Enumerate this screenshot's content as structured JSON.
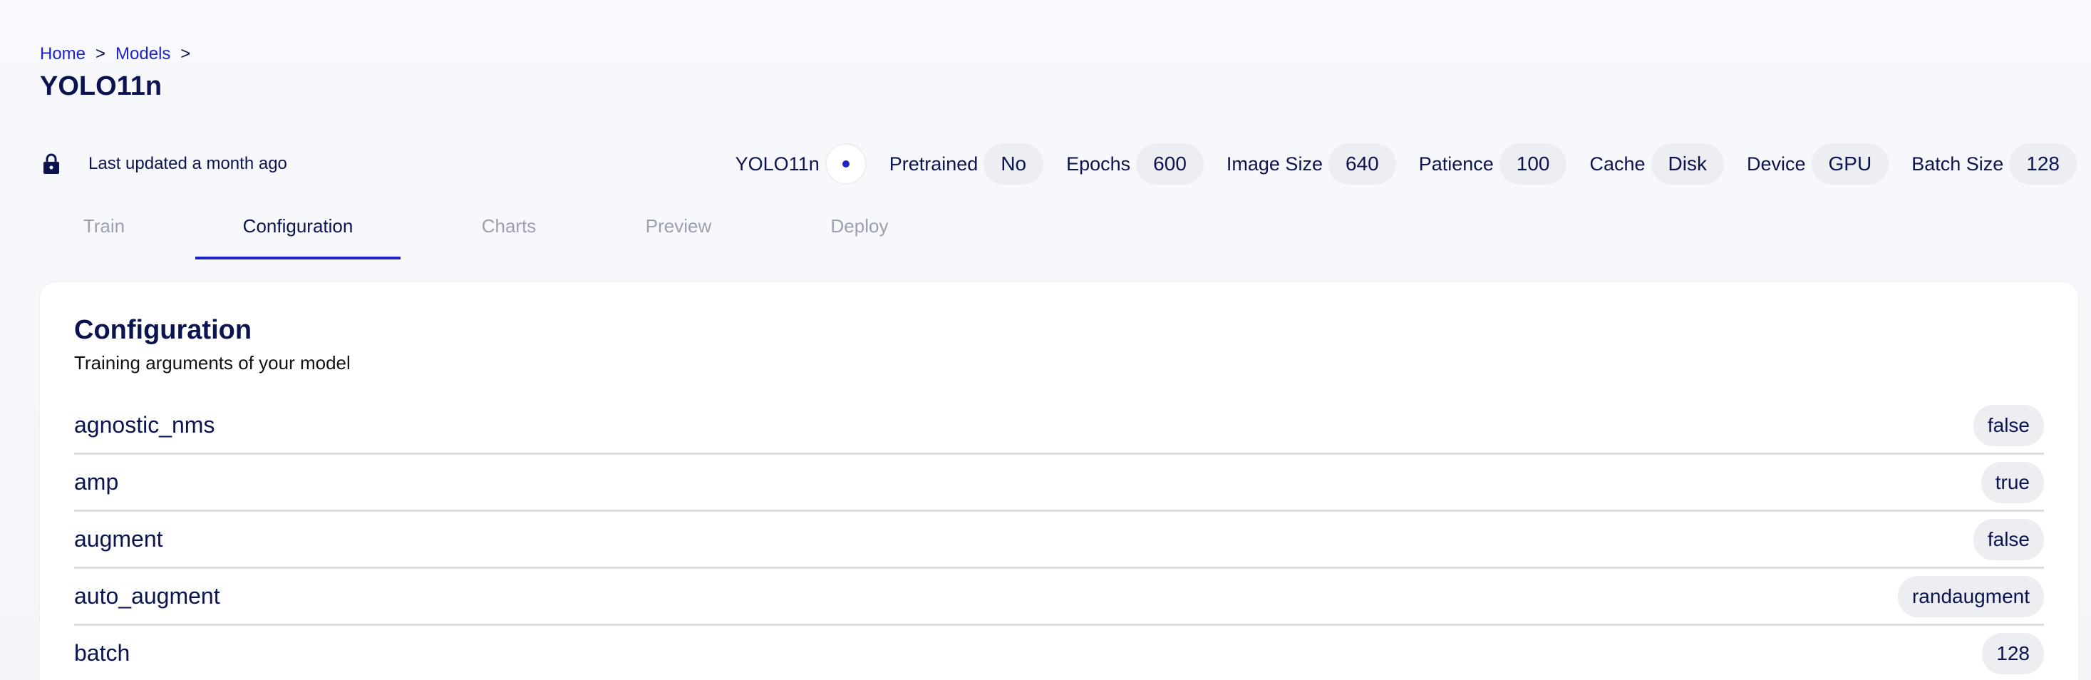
{
  "breadcrumb": {
    "items": [
      "Home",
      "Models"
    ],
    "separator": ">"
  },
  "page_title": "YOLO11n",
  "info": {
    "updated": "Last updated a month ago",
    "model_name": "YOLO11n",
    "meta": [
      {
        "label": "Pretrained",
        "value": "No"
      },
      {
        "label": "Epochs",
        "value": "600"
      },
      {
        "label": "Image Size",
        "value": "640"
      },
      {
        "label": "Patience",
        "value": "100"
      },
      {
        "label": "Cache",
        "value": "Disk"
      },
      {
        "label": "Device",
        "value": "GPU"
      },
      {
        "label": "Batch Size",
        "value": "128"
      }
    ]
  },
  "tabs": [
    "Train",
    "Configuration",
    "Charts",
    "Preview",
    "Deploy"
  ],
  "active_tab": "Configuration",
  "card": {
    "title": "Configuration",
    "subtitle": "Training arguments of your model",
    "rows": [
      {
        "key": "agnostic_nms",
        "value": "false"
      },
      {
        "key": "amp",
        "value": "true"
      },
      {
        "key": "augment",
        "value": "false"
      },
      {
        "key": "auto_augment",
        "value": "randaugment"
      },
      {
        "key": "batch",
        "value": "128"
      }
    ]
  },
  "colors": {
    "accent": "#1d22c9",
    "text": "#0b1450",
    "muted_tab": "#9aa0ad",
    "pill_bg": "#eceef2"
  },
  "icons": {
    "lock": "lock-icon",
    "status": "status-dot-icon"
  }
}
